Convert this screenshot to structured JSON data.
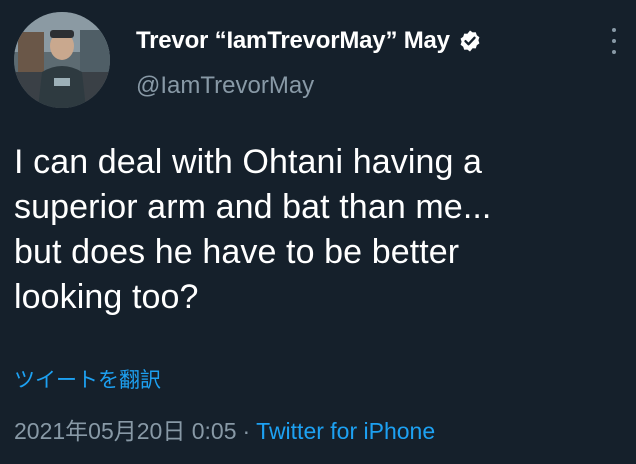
{
  "author": {
    "display_name": "Trevor “IamTrevorMay” May",
    "handle": "@IamTrevorMay",
    "verified": true,
    "avatar": "profile-photo"
  },
  "tweet": {
    "lines": [
      "I can deal with Ohtani having a",
      "superior arm and bat than me...",
      "but does he have to be better",
      "looking too?"
    ],
    "translate_label": "ツイートを翻訳",
    "timestamp": "2021年05月20日 0:05",
    "separator": "·",
    "source": "Twitter for iPhone"
  },
  "icons": {
    "verified": "verified-badge-icon",
    "more": "more-options-icon"
  },
  "colors": {
    "background": "#15202b",
    "text": "#ffffff",
    "secondary": "#8899a6",
    "accent": "#1da1f2"
  }
}
